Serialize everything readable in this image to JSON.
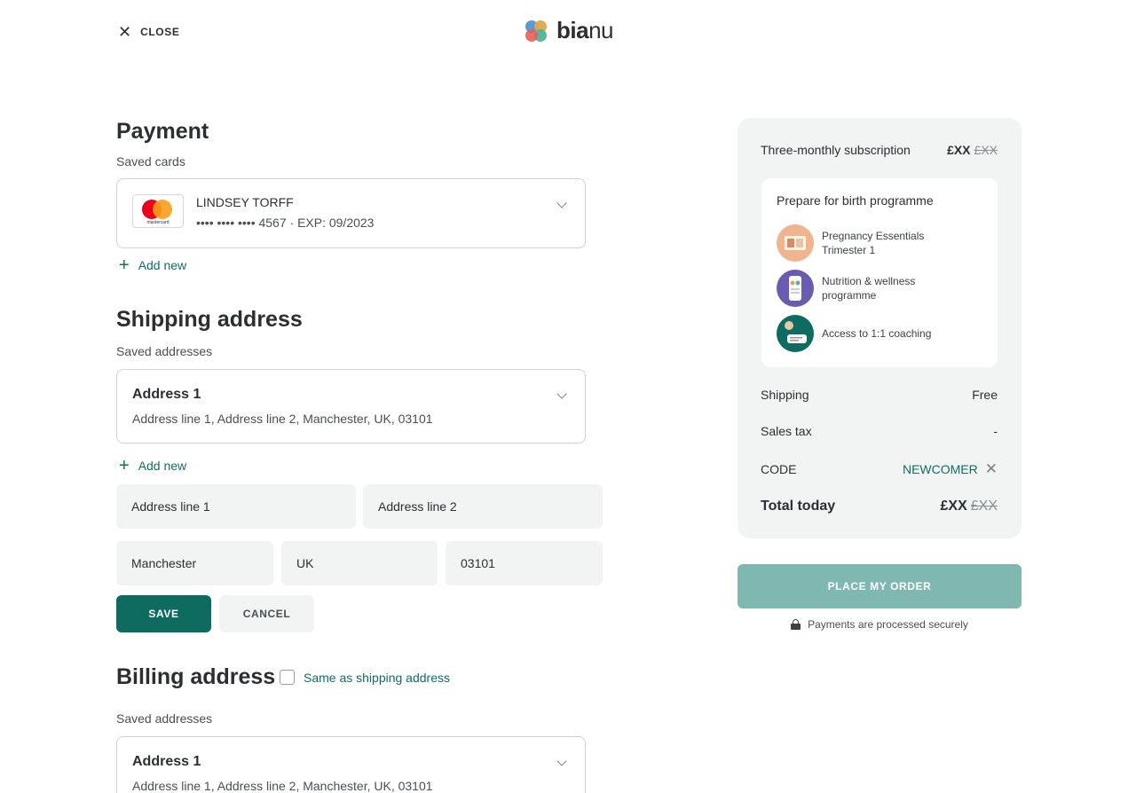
{
  "header": {
    "close_label": "CLOSE",
    "brand_bold": "bia",
    "brand_light": "nu"
  },
  "payment": {
    "title": "Payment",
    "saved_label": "Saved cards",
    "card": {
      "brand_icon": "mastercard-logo",
      "brand_text": "mastercard",
      "name": "LINDSEY TORFF",
      "number": "•••• •••• •••• 4567 · EXP: 09/2023"
    },
    "add_new": "Add new"
  },
  "shipping": {
    "title": "Shipping address",
    "saved_label": "Saved addresses",
    "address": {
      "name": "Address 1",
      "line": "Address line 1, Address line 2, Manchester, UK, 03101"
    },
    "add_new": "Add new",
    "form": {
      "line1": "Address line 1",
      "line2": "Address line 2",
      "city": "Manchester",
      "country": "UK",
      "postcode": "03101"
    },
    "save_label": "SAVE",
    "cancel_label": "CANCEL"
  },
  "billing": {
    "title": "Billing address",
    "same_as_shipping": "Same as shipping address",
    "same_checked": false,
    "saved_label": "Saved addresses",
    "address": {
      "name": "Address 1",
      "line": "Address line 1, Address line 2, Manchester, UK, 03101"
    }
  },
  "summary": {
    "subscription_label": "Three-monthly subscription",
    "subscription_price": "£XX",
    "subscription_old_price": "£XX",
    "programme": {
      "title": "Prepare for birth programme",
      "items": [
        {
          "label": "Pregnancy Essentials Trimester 1"
        },
        {
          "label": "Nutrition & wellness programme"
        },
        {
          "label": "Access to 1:1 coaching"
        }
      ]
    },
    "shipping_label": "Shipping",
    "shipping_value": "Free",
    "tax_label": "Sales tax",
    "tax_value": "-",
    "code_label": "CODE",
    "code_value": "NEWCOMER",
    "total_label": "Total today",
    "total_price": "£XX",
    "total_old_price": "£XX"
  },
  "order_button": "PLACE MY ORDER",
  "secure_note": "Payments are processed securely",
  "colors": {
    "accent": "#0d6b5f",
    "accent_light": "#7fb8b0",
    "panel_bg": "#f2f3f3"
  }
}
